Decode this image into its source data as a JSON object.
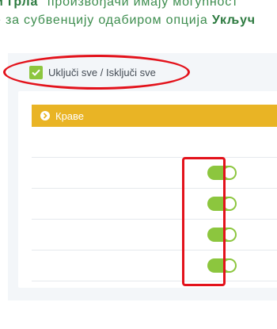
{
  "intro": {
    "line1_bold": "и грла",
    "line1_rest": "\" произвођачи имају могућност",
    "line2_rest": "е за субвенцију одабиром опција ",
    "line2_bold": "Укључ"
  },
  "toggle_all": {
    "label": "Uključi sve / Isključi sve",
    "checked": true
  },
  "card": {
    "header_label": "Краве",
    "rows": [
      {
        "toggle_on": null
      },
      {
        "toggle_on": true
      },
      {
        "toggle_on": true
      },
      {
        "toggle_on": true
      },
      {
        "toggle_on": true
      }
    ]
  },
  "colors": {
    "accent_green": "#8cc63e",
    "header_yellow": "#e9b425",
    "annotation_red": "#e3121b",
    "text_green": "#3d8d4e"
  }
}
